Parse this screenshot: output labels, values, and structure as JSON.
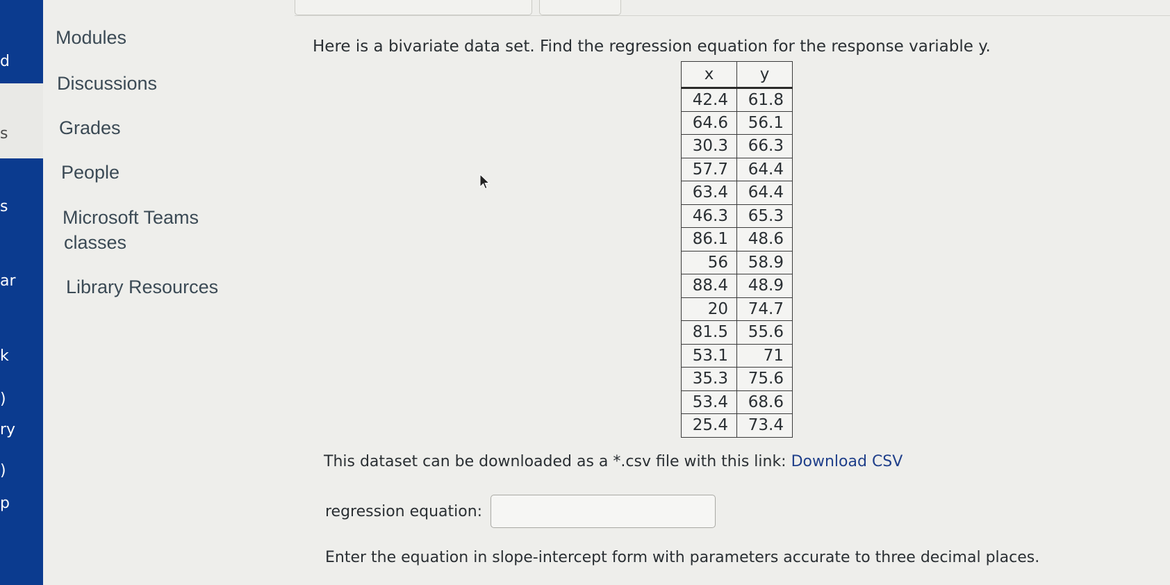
{
  "global_nav": {
    "fragments": [
      "d",
      "s",
      "s",
      "ar",
      "k",
      ")",
      "ry",
      ")",
      "p"
    ]
  },
  "course_nav": {
    "items": [
      {
        "label": "Modules"
      },
      {
        "label": "Discussions"
      },
      {
        "label": "Grades"
      },
      {
        "label": "People"
      },
      {
        "label": "Microsoft Teams"
      },
      {
        "label": "classes"
      },
      {
        "label": "Library Resources"
      }
    ]
  },
  "question": {
    "prompt": "Here is a bivariate data set. Find the regression equation for the response variable y.",
    "table": {
      "headers": [
        "x",
        "y"
      ],
      "rows": [
        [
          "42.4",
          "61.8"
        ],
        [
          "64.6",
          "56.1"
        ],
        [
          "30.3",
          "66.3"
        ],
        [
          "57.7",
          "64.4"
        ],
        [
          "63.4",
          "64.4"
        ],
        [
          "46.3",
          "65.3"
        ],
        [
          "86.1",
          "48.6"
        ],
        [
          "56",
          "58.9"
        ],
        [
          "88.4",
          "48.9"
        ],
        [
          "20",
          "74.7"
        ],
        [
          "81.5",
          "55.6"
        ],
        [
          "53.1",
          "71"
        ],
        [
          "35.3",
          "75.6"
        ],
        [
          "53.4",
          "68.6"
        ],
        [
          "25.4",
          "73.4"
        ]
      ]
    },
    "csv_text": "This dataset can be downloaded as a *.csv file with this link: ",
    "csv_link_label": "Download CSV",
    "answer_label": "regression equation:",
    "answer_value": "",
    "instructions": "Enter the equation in slope-intercept form with parameters accurate to three decimal places."
  },
  "colors": {
    "global_nav": "#0b3b8f",
    "link": "#1f3f8a",
    "background": "#eeeeeb"
  }
}
